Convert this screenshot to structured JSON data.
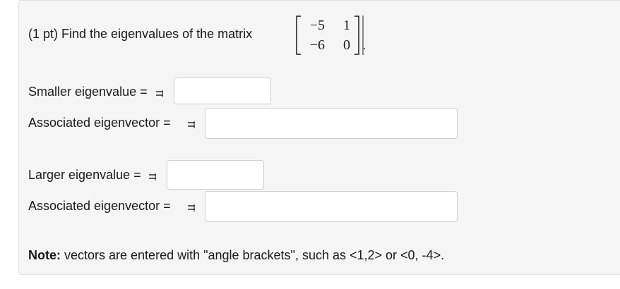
{
  "problem": {
    "prompt": "(1 pt) Find the eigenvalues of the matrix",
    "matrix": {
      "r1c1": "−5",
      "r1c2": "1",
      "r2c1": "−6",
      "r2c2": "0"
    },
    "period": "."
  },
  "fields": {
    "smaller_eigenvalue_label": "Smaller eigenvalue =",
    "smaller_eigenvalue_value": "",
    "smaller_eigenvector_label": "Associated eigenvector =",
    "smaller_eigenvector_value": "",
    "larger_eigenvalue_label": "Larger eigenvalue =",
    "larger_eigenvalue_value": "",
    "larger_eigenvector_label": "Associated eigenvector =",
    "larger_eigenvector_value": ""
  },
  "note": {
    "bold": "Note:",
    "text": " vectors are entered with \"angle brackets\", such as <1,2> or <0, -4>."
  },
  "icons": {
    "equals_preview": "equals-preview-icon"
  }
}
